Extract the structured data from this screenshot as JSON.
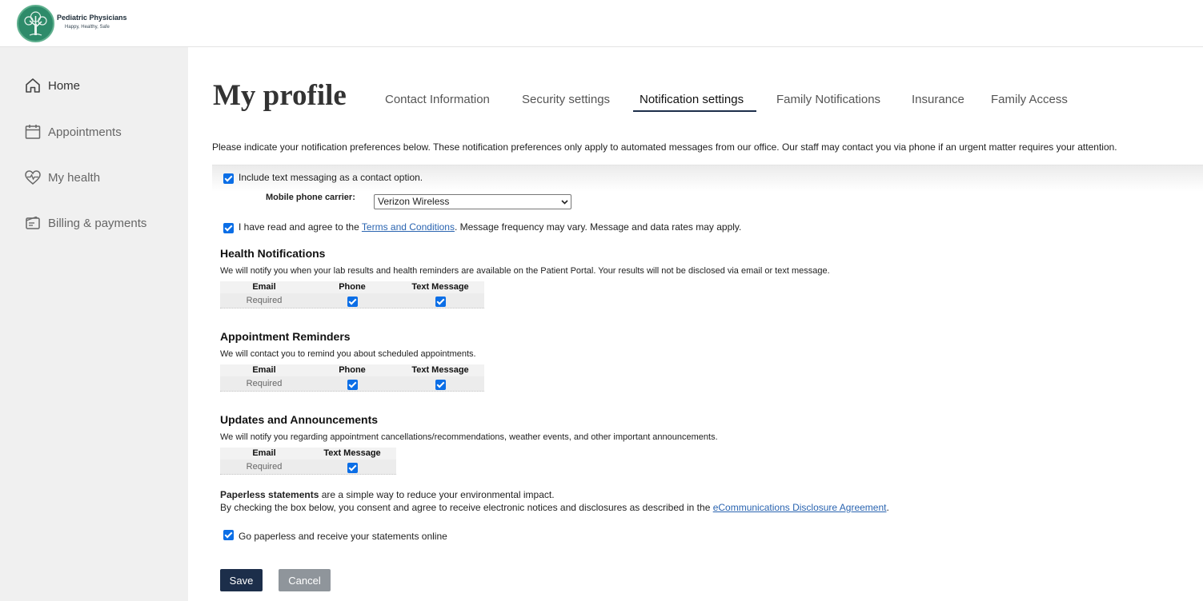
{
  "brand": {
    "name": "Pediatric Physicians",
    "tagline": "Happy, Healthy, Safe",
    "logo_icon": "tree-logo-icon"
  },
  "sidebar": {
    "items": [
      {
        "label": "Home",
        "icon": "home-icon"
      },
      {
        "label": "Appointments",
        "icon": "calendar-icon"
      },
      {
        "label": "My health",
        "icon": "heart-pulse-icon"
      },
      {
        "label": "Billing & payments",
        "icon": "wallet-icon"
      }
    ]
  },
  "page": {
    "title": "My profile",
    "tabs": [
      {
        "label": "Contact Information"
      },
      {
        "label": "Security settings"
      },
      {
        "label": "Notification settings",
        "active": true
      },
      {
        "label": "Family Notifications"
      },
      {
        "label": "Insurance"
      },
      {
        "label": "Family Access"
      }
    ],
    "intro": "Please indicate your notification preferences below. These notification preferences only apply to automated messages from our office. Our staff may contact you via phone if an urgent matter requires your attention."
  },
  "sms": {
    "include_label": "Include text messaging as a contact option.",
    "include_checked": true,
    "carrier_label": "Mobile phone carrier:",
    "carrier_value": "Verizon Wireless",
    "terms_prefix": "I have read and agree to the ",
    "terms_link": "Terms and Conditions",
    "terms_suffix": ". Message frequency may vary. Message and data rates may apply.",
    "terms_checked": true
  },
  "sections": {
    "health": {
      "title": "Health Notifications",
      "desc": "We will notify you when your lab results and health reminders are available on the Patient Portal. Your results will not be disclosed via email or text message.",
      "headers": [
        "Email",
        "Phone",
        "Text Message"
      ],
      "email_value": "Required",
      "phone_checked": true,
      "text_checked": true
    },
    "appointments": {
      "title": "Appointment Reminders",
      "desc": "We will contact you to remind you about scheduled appointments.",
      "headers": [
        "Email",
        "Phone",
        "Text Message"
      ],
      "email_value": "Required",
      "phone_checked": true,
      "text_checked": true
    },
    "updates": {
      "title": "Updates and Announcements",
      "desc": "We will notify you regarding appointment cancellations/recommendations, weather events, and other important announcements.",
      "headers": [
        "Email",
        "Text Message"
      ],
      "email_value": "Required",
      "text_checked": true
    }
  },
  "paperless": {
    "bold": "Paperless statements",
    "line1_rest": " are a simple way to reduce your environmental impact.",
    "line2_prefix": "By checking the box below, you consent and agree to receive electronic notices and disclosures as described in the ",
    "line2_link": "eCommunications Disclosure Agreement",
    "line2_suffix": ".",
    "checkbox_label": "Go paperless and receive your statements online",
    "checked": true
  },
  "buttons": {
    "save": "Save",
    "cancel": "Cancel"
  },
  "colors": {
    "primary": "#1c2e4a",
    "checkbox": "#0b6ee6",
    "link": "#2a64b0",
    "cancel": "#8f959b",
    "sidebar_bg": "#f0f0f0"
  }
}
